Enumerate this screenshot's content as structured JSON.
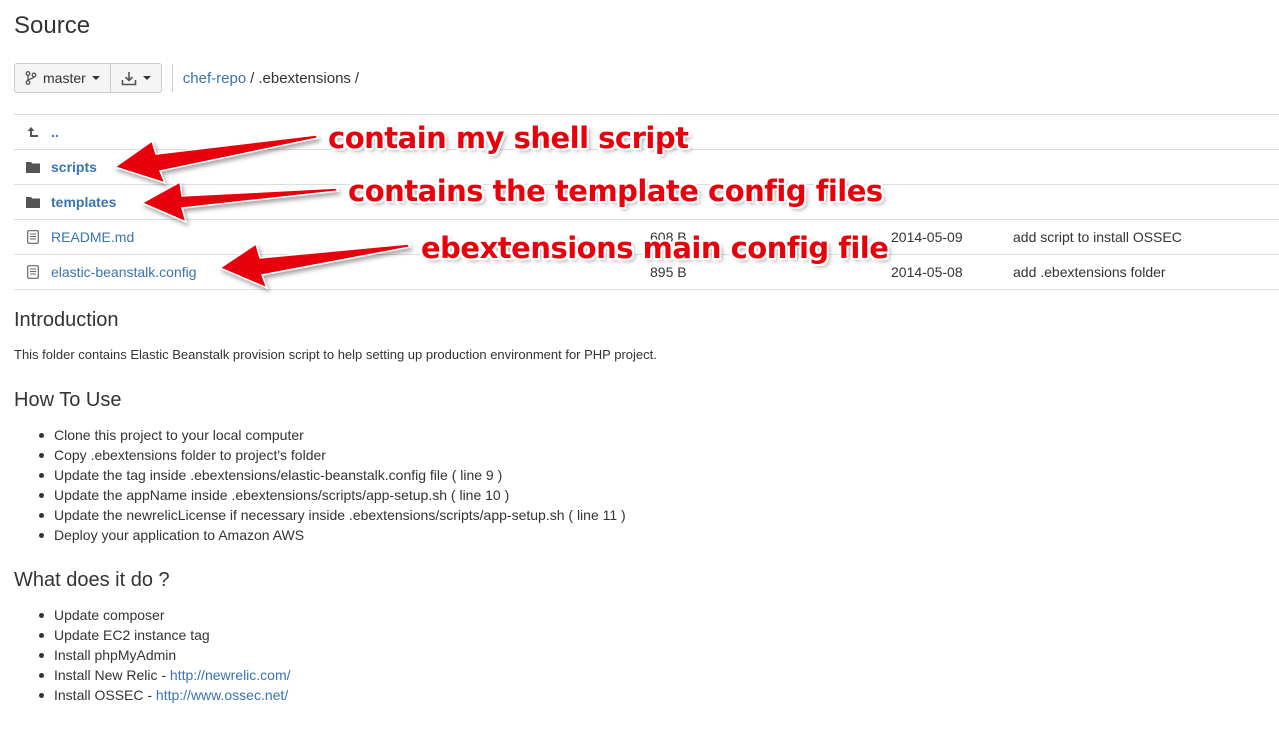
{
  "page": {
    "title": "Source"
  },
  "toolbar": {
    "branch_label": "master"
  },
  "breadcrumb": {
    "repo": "chef-repo",
    "separator": "/",
    "folder": ".ebextensions",
    "trail": "/"
  },
  "files": [
    {
      "name": "..",
      "type": "parent",
      "size": "",
      "date": "",
      "message": ""
    },
    {
      "name": "scripts",
      "type": "folder",
      "size": "",
      "date": "",
      "message": ""
    },
    {
      "name": "templates",
      "type": "folder",
      "size": "",
      "date": "",
      "message": ""
    },
    {
      "name": "README.md",
      "type": "file",
      "size": "608 B",
      "date": "2014-05-09",
      "message": "add script to install OSSEC"
    },
    {
      "name": "elastic-beanstalk.config",
      "type": "file",
      "size": "895 B",
      "date": "2014-05-08",
      "message": "add .ebextensions folder"
    }
  ],
  "readme": {
    "intro_heading": "Introduction",
    "intro_text": "This folder contains Elastic Beanstalk provision script to help setting up production environment for PHP project.",
    "howto_heading": "How To Use",
    "howto_items": [
      "Clone this project to your local computer",
      "Copy .ebextensions folder to project's folder",
      "Update the tag inside .ebextensions/elastic-beanstalk.config file ( line 9 )",
      "Update the appName inside .ebextensions/scripts/app-setup.sh ( line 10 )",
      "Update the newrelicLicense if necessary inside .ebextensions/scripts/app-setup.sh ( line 11 )",
      "Deploy your application to Amazon AWS"
    ],
    "what_heading": "What does it do ?",
    "what_items": [
      {
        "text": "Update composer",
        "link": ""
      },
      {
        "text": "Update EC2 instance tag",
        "link": ""
      },
      {
        "text": "Install phpMyAdmin",
        "link": ""
      },
      {
        "text": "Install New Relic - ",
        "link": "http://newrelic.com/"
      },
      {
        "text": "Install OSSEC - ",
        "link": "http://www.ossec.net/"
      }
    ]
  },
  "annotations": {
    "scripts": "contain my shell script",
    "templates": "contains the template config files",
    "config": "ebextensions main config file",
    "color": "#e8000b"
  }
}
